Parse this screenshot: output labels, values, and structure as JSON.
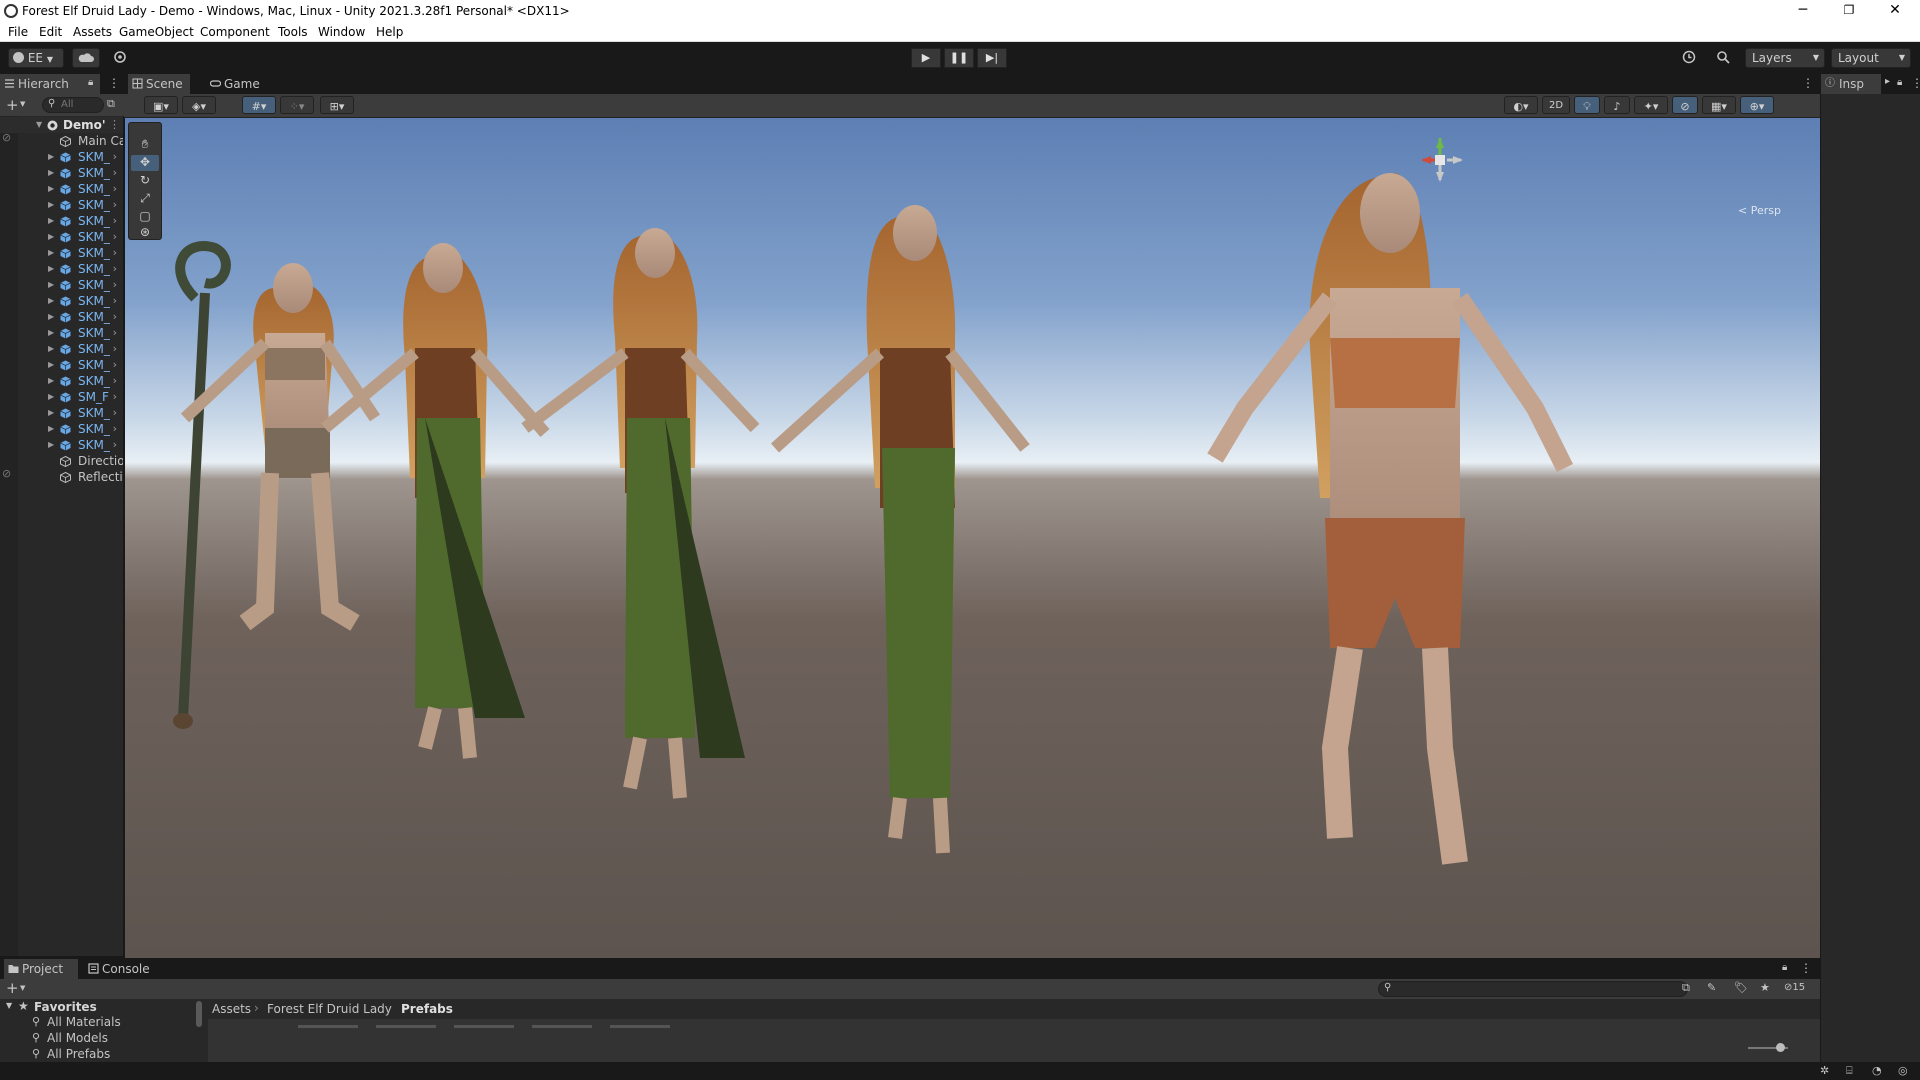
{
  "window": {
    "title": "Forest Elf Druid Lady - Demo - Windows, Mac, Linux - Unity 2021.3.28f1 Personal* <DX11>",
    "controls": {
      "minimize": "─",
      "restore": "❐",
      "close": "✕"
    }
  },
  "menu": [
    "File",
    "Edit",
    "Assets",
    "GameObject",
    "Component",
    "Tools",
    "Window",
    "Help"
  ],
  "toolbar": {
    "account_label": "EE",
    "layers_label": "Layers",
    "layout_label": "Layout"
  },
  "hierarchy": {
    "tab_label": "Hierarch",
    "search_placeholder": "All",
    "scene_name": "Demo'",
    "items": [
      {
        "label": "Main Ca",
        "type": "camera",
        "color": "#c4c4c4",
        "expandable": false
      },
      {
        "label": "SKM_",
        "type": "prefab",
        "color": "#7bb6f0",
        "expandable": true
      },
      {
        "label": "SKM_",
        "type": "prefab",
        "color": "#7bb6f0",
        "expandable": true
      },
      {
        "label": "SKM_",
        "type": "prefab",
        "color": "#7bb6f0",
        "expandable": true
      },
      {
        "label": "SKM_",
        "type": "prefab",
        "color": "#7bb6f0",
        "expandable": true
      },
      {
        "label": "SKM_",
        "type": "prefab",
        "color": "#7bb6f0",
        "expandable": true
      },
      {
        "label": "SKM_",
        "type": "prefab",
        "color": "#7bb6f0",
        "expandable": true
      },
      {
        "label": "SKM_",
        "type": "prefab",
        "color": "#7bb6f0",
        "expandable": true
      },
      {
        "label": "SKM_",
        "type": "prefab",
        "color": "#7bb6f0",
        "expandable": true
      },
      {
        "label": "SKM_",
        "type": "prefab",
        "color": "#7bb6f0",
        "expandable": true
      },
      {
        "label": "SKM_",
        "type": "prefab",
        "color": "#7bb6f0",
        "expandable": true
      },
      {
        "label": "SKM_",
        "type": "prefab",
        "color": "#7bb6f0",
        "expandable": true
      },
      {
        "label": "SKM_",
        "type": "prefab",
        "color": "#7bb6f0",
        "expandable": true
      },
      {
        "label": "SKM_",
        "type": "prefab",
        "color": "#7bb6f0",
        "expandable": true
      },
      {
        "label": "SKM_",
        "type": "prefab",
        "color": "#7bb6f0",
        "expandable": true
      },
      {
        "label": "SKM_",
        "type": "prefab",
        "color": "#7bb6f0",
        "expandable": true
      },
      {
        "label": "SM_F",
        "type": "prefab",
        "color": "#7bb6f0",
        "expandable": true
      },
      {
        "label": "SKM_",
        "type": "prefab",
        "color": "#7bb6f0",
        "expandable": true
      },
      {
        "label": "SKM_",
        "type": "prefab",
        "color": "#7bb6f0",
        "expandable": true
      },
      {
        "label": "SKM_",
        "type": "prefab",
        "color": "#7bb6f0",
        "expandable": true
      },
      {
        "label": "Directio",
        "type": "object",
        "color": "#c4c4c4",
        "expandable": false
      },
      {
        "label": "Reflecti",
        "type": "object",
        "color": "#c4c4c4",
        "expandable": false
      }
    ]
  },
  "scene": {
    "tabs": [
      {
        "label": "Scene",
        "icon": "grid-icon",
        "active": true
      },
      {
        "label": "Game",
        "icon": "gamepad-icon",
        "active": false
      }
    ],
    "toggle_2d_label": "2D",
    "gizmo_persp_label": "< Persp",
    "gizmo_axes": {
      "y": "y",
      "x": "x",
      "z": "z"
    }
  },
  "inspector": {
    "tab_label": "Insp"
  },
  "project": {
    "tabs": [
      {
        "label": "Project",
        "icon": "folder-icon",
        "active": true
      },
      {
        "label": "Console",
        "icon": "console-icon",
        "active": false
      }
    ],
    "favorites_label": "Favorites",
    "favorites": [
      "All Materials",
      "All Models",
      "All Prefabs"
    ],
    "breadcrumb": [
      "Assets",
      "Forest Elf Druid Lady",
      "Prefabs"
    ],
    "hidden_count": "15"
  }
}
